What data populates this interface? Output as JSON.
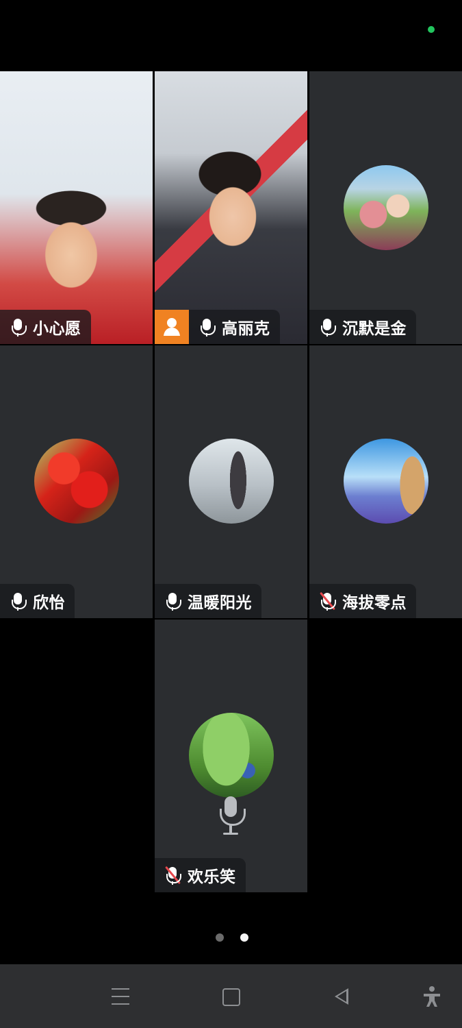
{
  "participants": [
    {
      "name": "小心愿",
      "audio": "on",
      "video": "on",
      "role": ""
    },
    {
      "name": "高丽克",
      "audio": "on",
      "video": "on",
      "role": "host"
    },
    {
      "name": "沉默是金",
      "audio": "on",
      "video": "off",
      "role": ""
    },
    {
      "name": "欣怡",
      "audio": "on",
      "video": "off",
      "role": ""
    },
    {
      "name": "温暖阳光",
      "audio": "on",
      "video": "off",
      "role": ""
    },
    {
      "name": "海拔零点",
      "audio": "muted",
      "video": "off",
      "role": ""
    },
    {
      "name": "欢乐笑",
      "audio": "muted",
      "video": "off",
      "role": ""
    }
  ],
  "pager": {
    "current": 2,
    "total": 2
  },
  "icons": {
    "connection": "green-dot-icon",
    "microphone": "microphone-icon",
    "muted_microphone": "microphone-muted-icon",
    "host": "host-person-icon",
    "nav_menu": "menu-icon",
    "nav_home": "home-icon",
    "nav_back": "back-icon",
    "nav_accessibility": "accessibility-icon"
  },
  "colors": {
    "active_speaker_border": "#2fbf5b",
    "host_badge": "#f08222",
    "muted_slash": "#e5484d"
  }
}
